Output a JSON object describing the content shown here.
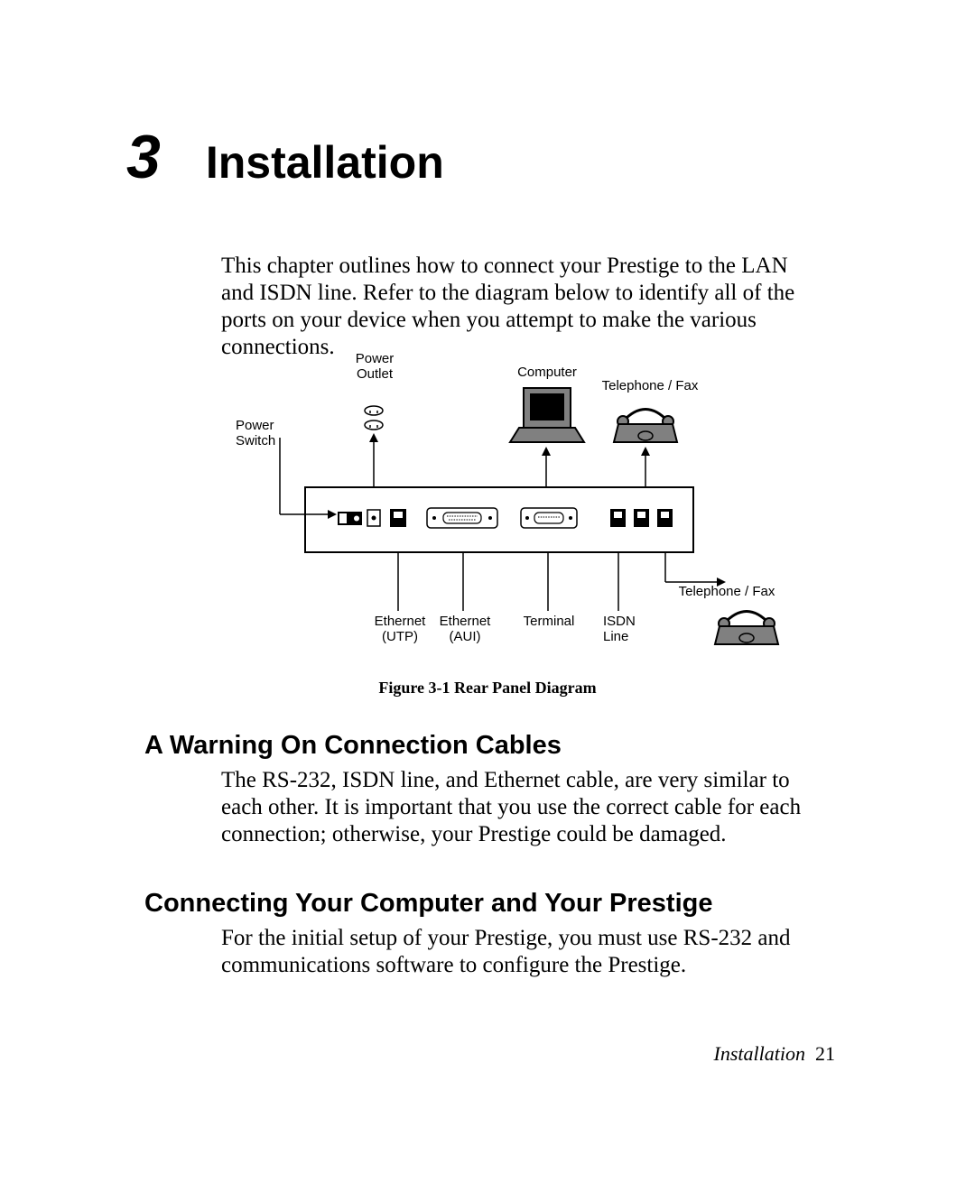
{
  "chapter": {
    "number": "3",
    "title": "Installation"
  },
  "intro": "This chapter outlines how to connect your Prestige to the LAN and ISDN line. Refer to the diagram below to identify all of the ports on your device when you attempt to make the various connections.",
  "figure_caption": "Figure 3-1 Rear Panel Diagram",
  "diagram_labels": {
    "power_outlet": "Power\nOutlet",
    "power_switch": "Power\nSwitch",
    "computer": "Computer",
    "telephone_fax_top": "Telephone / Fax",
    "telephone_fax_right": "Telephone / Fax",
    "ethernet_utp": "Ethernet\n(UTP)",
    "ethernet_aui": "Ethernet\n(AUI)",
    "terminal": "Terminal",
    "isdn_line": "ISDN\nLine"
  },
  "sections": {
    "warning": {
      "heading": "A Warning On Connection Cables",
      "body": "The RS-232, ISDN line, and Ethernet cable, are very similar to each other. It is important that you use the correct cable for each connection; otherwise, your Prestige could be damaged."
    },
    "connecting": {
      "heading": "Connecting Your Computer and Your Prestige",
      "body": "For the initial setup of your Prestige, you must use RS-232 and communications software to configure the Prestige."
    }
  },
  "footer": {
    "section": "Installation",
    "page_number": "21"
  }
}
